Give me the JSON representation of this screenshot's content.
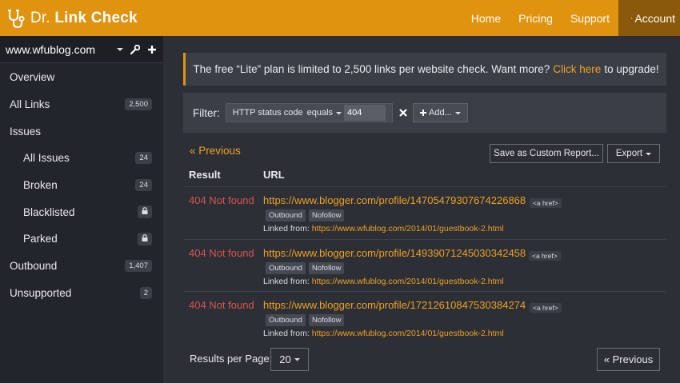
{
  "header": {
    "brand_prefix": "Dr.",
    "brand_name": "Link Check",
    "nav": [
      "Home",
      "Pricing",
      "Support"
    ],
    "account_label": "Account",
    "accent_color": "#e0930f"
  },
  "sidebar": {
    "site": "www.wfublog.com",
    "items": [
      {
        "label": "Overview",
        "badge": ""
      },
      {
        "label": "All Links",
        "badge": "2,500"
      },
      {
        "label": "Issues",
        "badge": ""
      },
      {
        "label": "All Issues",
        "badge": "24"
      },
      {
        "label": "Broken",
        "badge": "24"
      },
      {
        "label": "Blacklisted",
        "badge": "lock-icon"
      },
      {
        "label": "Parked",
        "badge": "lock-icon"
      },
      {
        "label": "Outbound",
        "badge": "1,407"
      },
      {
        "label": "Unsupported",
        "badge": "2"
      }
    ]
  },
  "notice": {
    "text_before": "The free “Lite” plan is limited to 2,500 links per website check. Want more?",
    "link_text": "Click here",
    "text_after": "to upgrade!"
  },
  "filter": {
    "label": "Filter:",
    "field": "HTTP status code",
    "operator": "equals",
    "value": "404",
    "add_label": "Add..."
  },
  "pagination": {
    "prev_link": "« Previous",
    "prev_button": "« Previous",
    "results_per_page_label": "Results per Page:",
    "results_per_page_value": "20"
  },
  "actions": {
    "save_report": "Save as Custom Report...",
    "export": "Export"
  },
  "table": {
    "headers": [
      "Result",
      "URL"
    ],
    "rows": [
      {
        "status": "404 Not found",
        "url": "https://www.blogger.com/profile/14705479307674226868",
        "tag": "<a href>",
        "chips": [
          "Outbound",
          "Nofollow"
        ],
        "linked_label": "Linked from:",
        "linked_url": "https://www.wfublog.com/2014/01/guestbook-2.html"
      },
      {
        "status": "404 Not found",
        "url": "https://www.blogger.com/profile/14939071245030342458",
        "tag": "<a href>",
        "chips": [
          "Outbound",
          "Nofollow"
        ],
        "linked_label": "Linked from:",
        "linked_url": "https://www.wfublog.com/2014/01/guestbook-2.html"
      },
      {
        "status": "404 Not found",
        "url": "https://www.blogger.com/profile/17212610847530384274",
        "tag": "<a href>",
        "chips": [
          "Outbound",
          "Nofollow"
        ],
        "linked_label": "Linked from:",
        "linked_url": "https://www.wfublog.com/2014/01/guestbook-2.html"
      }
    ]
  }
}
